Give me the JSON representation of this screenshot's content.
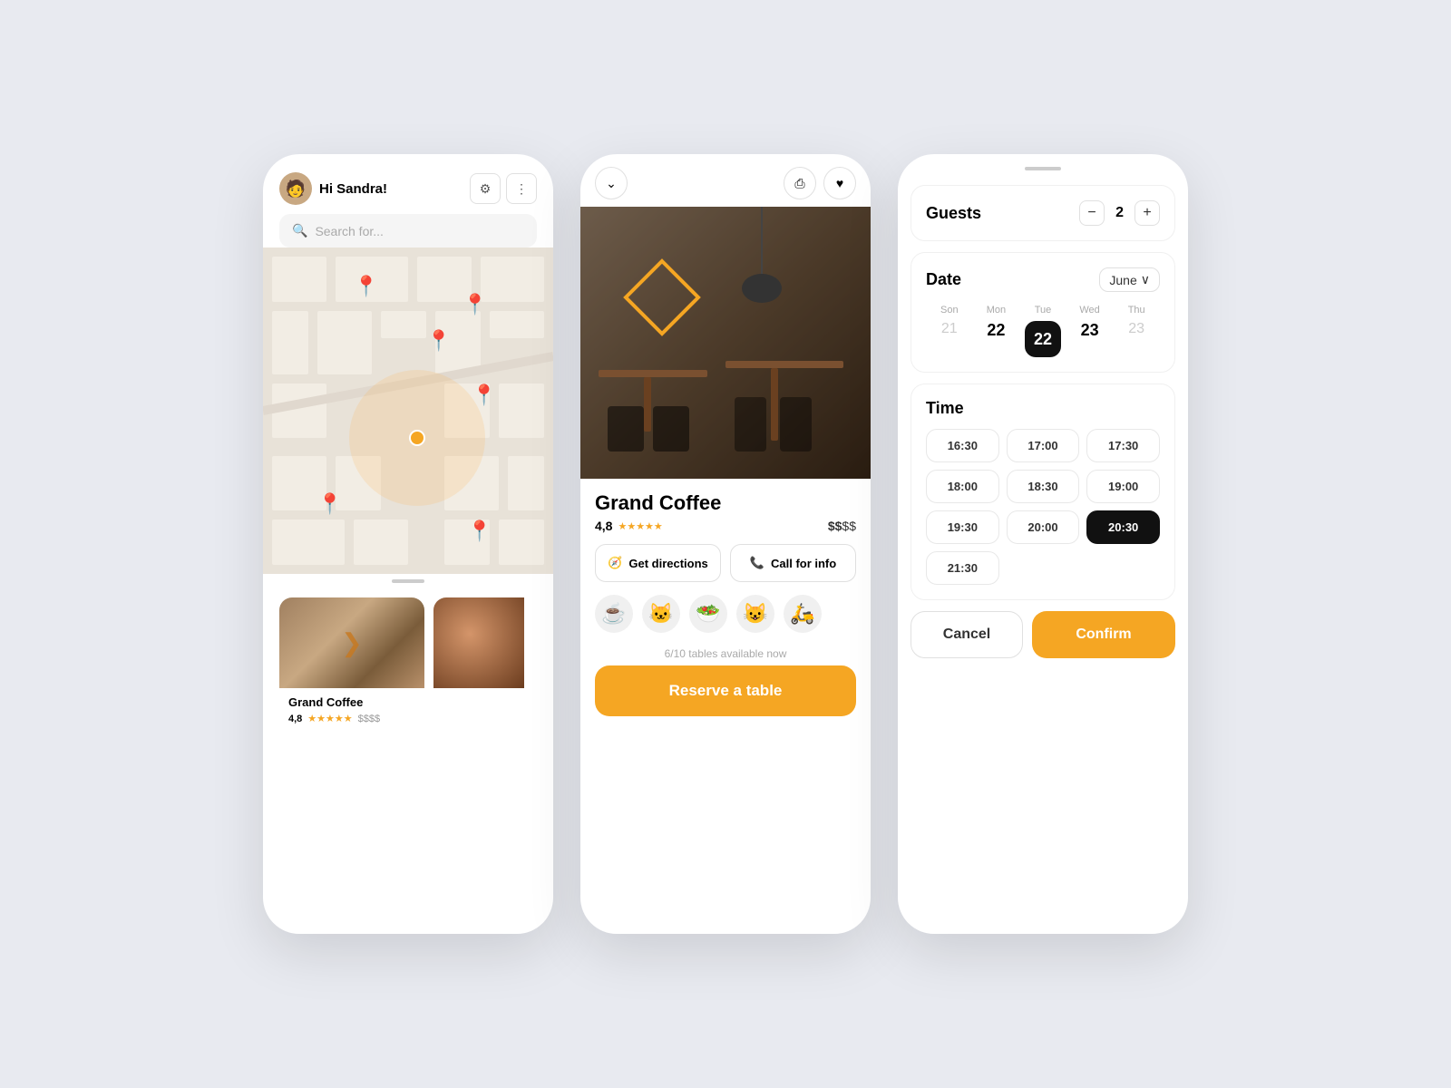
{
  "phone1": {
    "greeting": "Hi Sandra!",
    "search_placeholder": "Search for...",
    "filter_icon": "⚙",
    "more_icon": "⋮",
    "card1": {
      "name": "Grand Coffee",
      "rating": "4,8",
      "price": "$$$$"
    }
  },
  "phone2": {
    "restaurant_name": "Grand Coffee",
    "rating": "4,8",
    "price_light": "$$",
    "price_dark": "$$",
    "btn_directions": "Get directions",
    "btn_call": "Call for info",
    "availability": "6/10 tables available now",
    "reserve_btn": "Reserve a table",
    "emojis": [
      "☕",
      "🐱",
      "🥗",
      "😺",
      "🛵"
    ]
  },
  "phone3": {
    "guests_label": "Guests",
    "guests_count": "2",
    "date_label": "Date",
    "month": "June",
    "calendar": [
      {
        "day": "Son",
        "num": "21",
        "light": true
      },
      {
        "day": "Mon",
        "num": "22",
        "light": false
      },
      {
        "day": "Tue",
        "num": "22",
        "active": true
      },
      {
        "day": "Wed",
        "num": "23",
        "light": false
      },
      {
        "day": "Thu",
        "num": "23",
        "light": false
      }
    ],
    "time_label": "Time",
    "times": [
      {
        "val": "16:30",
        "selected": false
      },
      {
        "val": "17:00",
        "selected": false
      },
      {
        "val": "17:30",
        "selected": false
      },
      {
        "val": "18:00",
        "selected": false
      },
      {
        "val": "18:30",
        "selected": false
      },
      {
        "val": "19:00",
        "selected": false
      },
      {
        "val": "19:30",
        "selected": false
      },
      {
        "val": "20:00",
        "selected": false
      },
      {
        "val": "20:30",
        "selected": true
      },
      {
        "val": "21:30",
        "selected": false
      }
    ],
    "cancel_label": "Cancel",
    "confirm_label": "Confirm"
  }
}
